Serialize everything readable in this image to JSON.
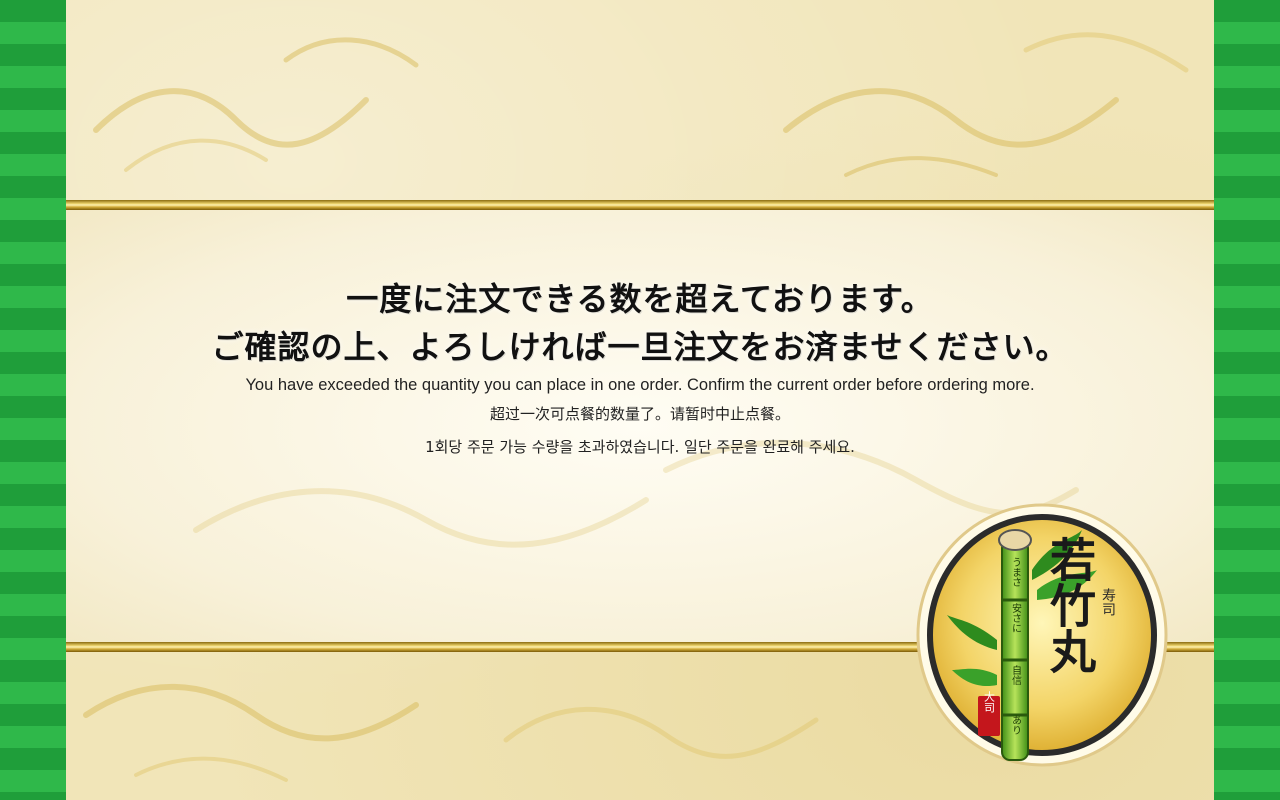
{
  "message": {
    "ja_line1": "一度に注文できる数を超えております。",
    "ja_line2": "ご確認の上、よろしければ一旦注文をお済ませください。",
    "en": "You have exceeded the quantity you can place in one order. Confirm the current order before ordering more.",
    "zh": "超过一次可点餐的数量了。请暂时中止点餐。",
    "ko": "1회당 주문 가능 수량을 초과하였습니다. 일단 주문을 완료해 주세요."
  },
  "logo": {
    "brand": "若竹丸",
    "sub": "寿司",
    "vertical_1": "うまさ",
    "vertical_2": "安さに",
    "vertical_3": "自信",
    "vertical_4": "あり",
    "stamp": "大司"
  },
  "colors": {
    "rail_green": "#1f9e3a",
    "rail_green_light": "#2fb84a",
    "gold": "#d3ad3a",
    "parchment": "#f1e5b8"
  }
}
